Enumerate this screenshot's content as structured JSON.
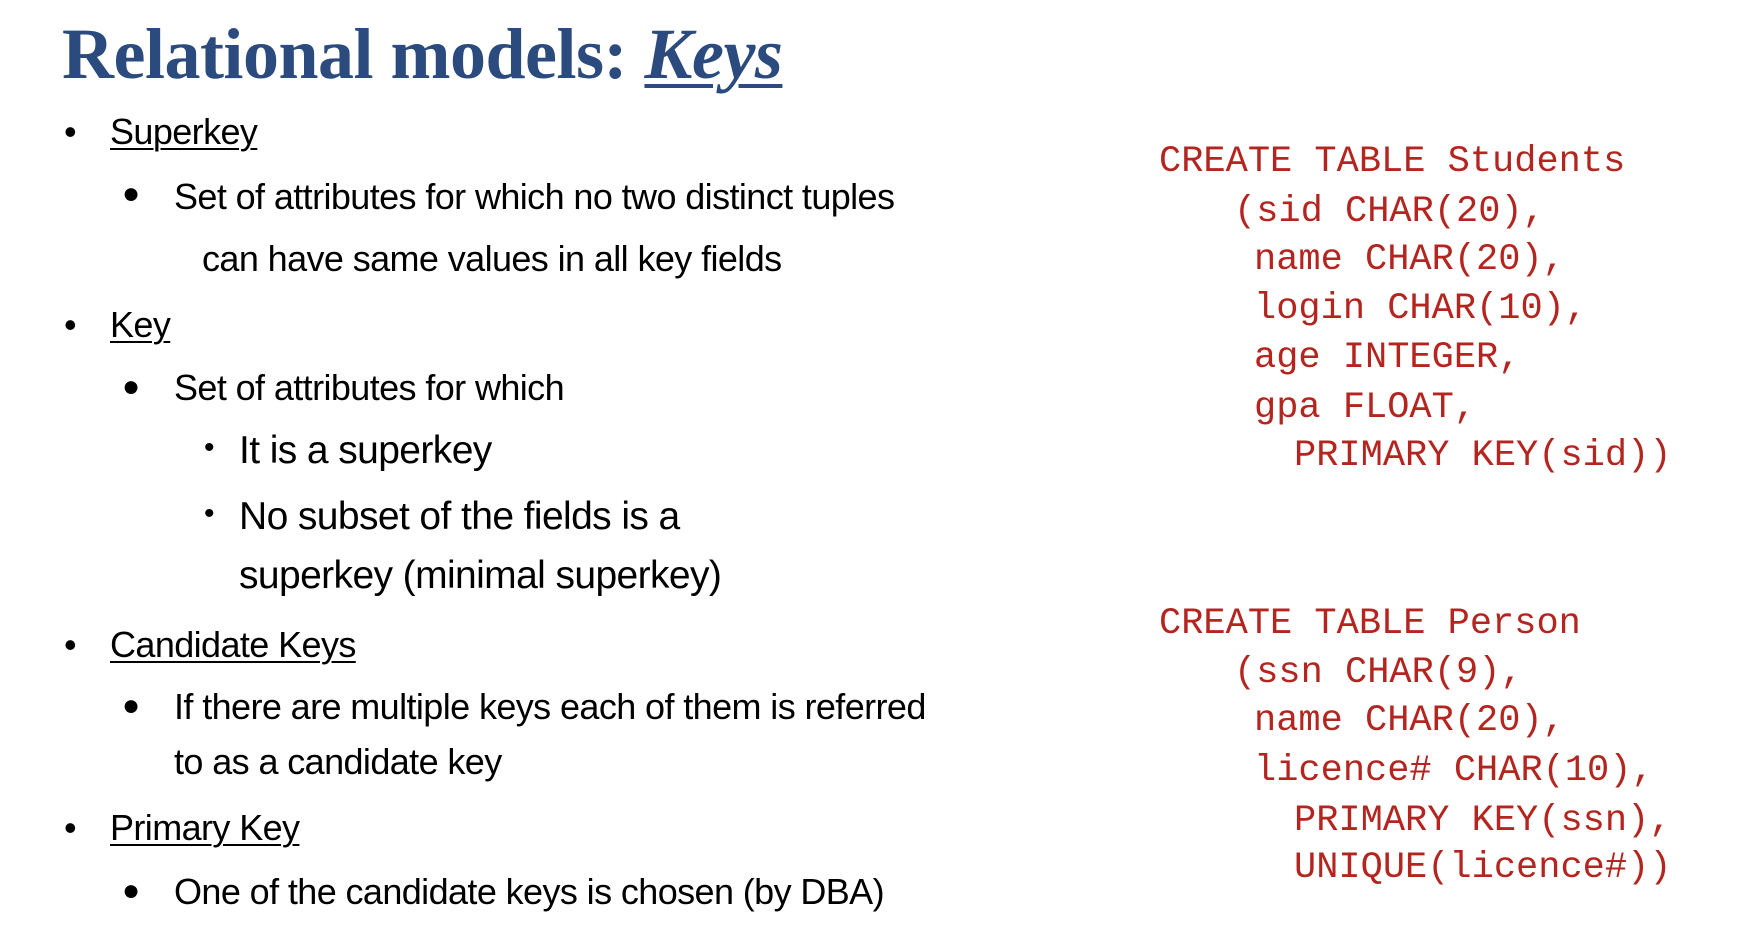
{
  "title": {
    "prefix": "Relational models: ",
    "emphasis": "Keys"
  },
  "bullet_glyph": "•",
  "sub_bullet_glyph": "●",
  "sections": [
    {
      "heading": "Superkey",
      "lines": [
        "Set of attributes for which no two distinct tuples",
        "can have same values in all key fields"
      ]
    },
    {
      "heading": "Key",
      "lines": [
        "Set of attributes for which"
      ],
      "subpoints": [
        "It is a superkey",
        "No subset of the fields is a",
        "superkey (minimal superkey)"
      ]
    },
    {
      "heading": "Candidate Keys",
      "lines": [
        "If there are multiple keys each of them is referred",
        "to as a candidate key"
      ]
    },
    {
      "heading": "Primary Key",
      "lines": [
        "One of the candidate keys is chosen (by DBA)"
      ]
    }
  ],
  "code": {
    "color": "#b5251f",
    "students": [
      "CREATE TABLE Students",
      "(sid CHAR(20),",
      "name CHAR(20),",
      "login CHAR(10),",
      "age INTEGER,",
      "gpa FLOAT,",
      "PRIMARY KEY(sid))"
    ],
    "person": [
      "CREATE TABLE Person",
      "(ssn CHAR(9),",
      "name CHAR(20),",
      "licence# CHAR(10),",
      "PRIMARY KEY(ssn),",
      "UNIQUE(licence#))"
    ]
  }
}
